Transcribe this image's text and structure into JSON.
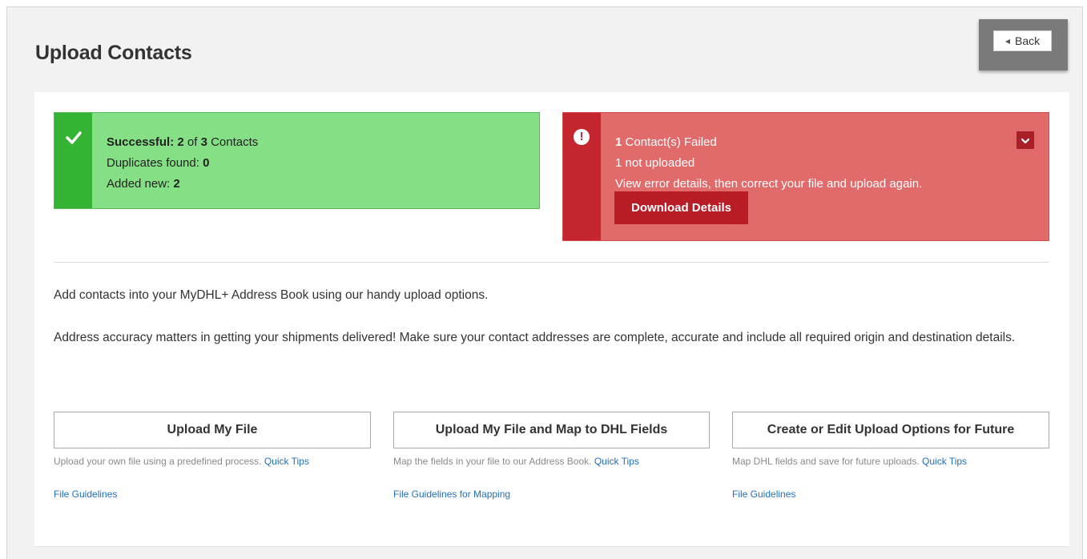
{
  "header": {
    "title": "Upload Contacts",
    "back_label": "Back"
  },
  "success": {
    "label": "Successful:",
    "count": "2",
    "of": "of",
    "total": "3",
    "unit": "Contacts",
    "duplicates_label": "Duplicates found:",
    "duplicates_value": "0",
    "added_label": "Added new:",
    "added_value": "2"
  },
  "failed": {
    "count": "1",
    "failed_label": "Contact(s) Failed",
    "not_uploaded": "1 not uploaded",
    "message": "View error details, then correct your file and upload again.",
    "download_label": "Download Details"
  },
  "intro": {
    "line1": "Add contacts into your MyDHL+ Address Book using our handy upload options.",
    "line2": "Address accuracy matters in getting your shipments delivered! Make sure your contact addresses are complete, accurate and include all required origin and destination details."
  },
  "options": [
    {
      "button": "Upload My File",
      "description": "Upload your own file using a predefined process.",
      "tips": "Quick Tips",
      "guidelines": "File Guidelines"
    },
    {
      "button": "Upload My File and Map to DHL Fields",
      "description": "Map the fields in your file to our Address Book.",
      "tips": "Quick Tips",
      "guidelines": "File Guidelines for Mapping"
    },
    {
      "button": "Create or Edit Upload Options for Future",
      "description": "Map DHL fields and save for future uploads.",
      "tips": "Quick Tips",
      "guidelines": "File Guidelines"
    }
  ],
  "colors": {
    "success_bg": "#85e085",
    "success_bar": "#34b334",
    "error_bg": "#e16a6a",
    "error_bar": "#c5262e",
    "link": "#1f6fba"
  },
  "icons": {
    "success": "checkmark-icon",
    "error": "exclamation-circle-icon",
    "toggle": "chevron-down-icon",
    "back": "chevron-left-icon"
  }
}
